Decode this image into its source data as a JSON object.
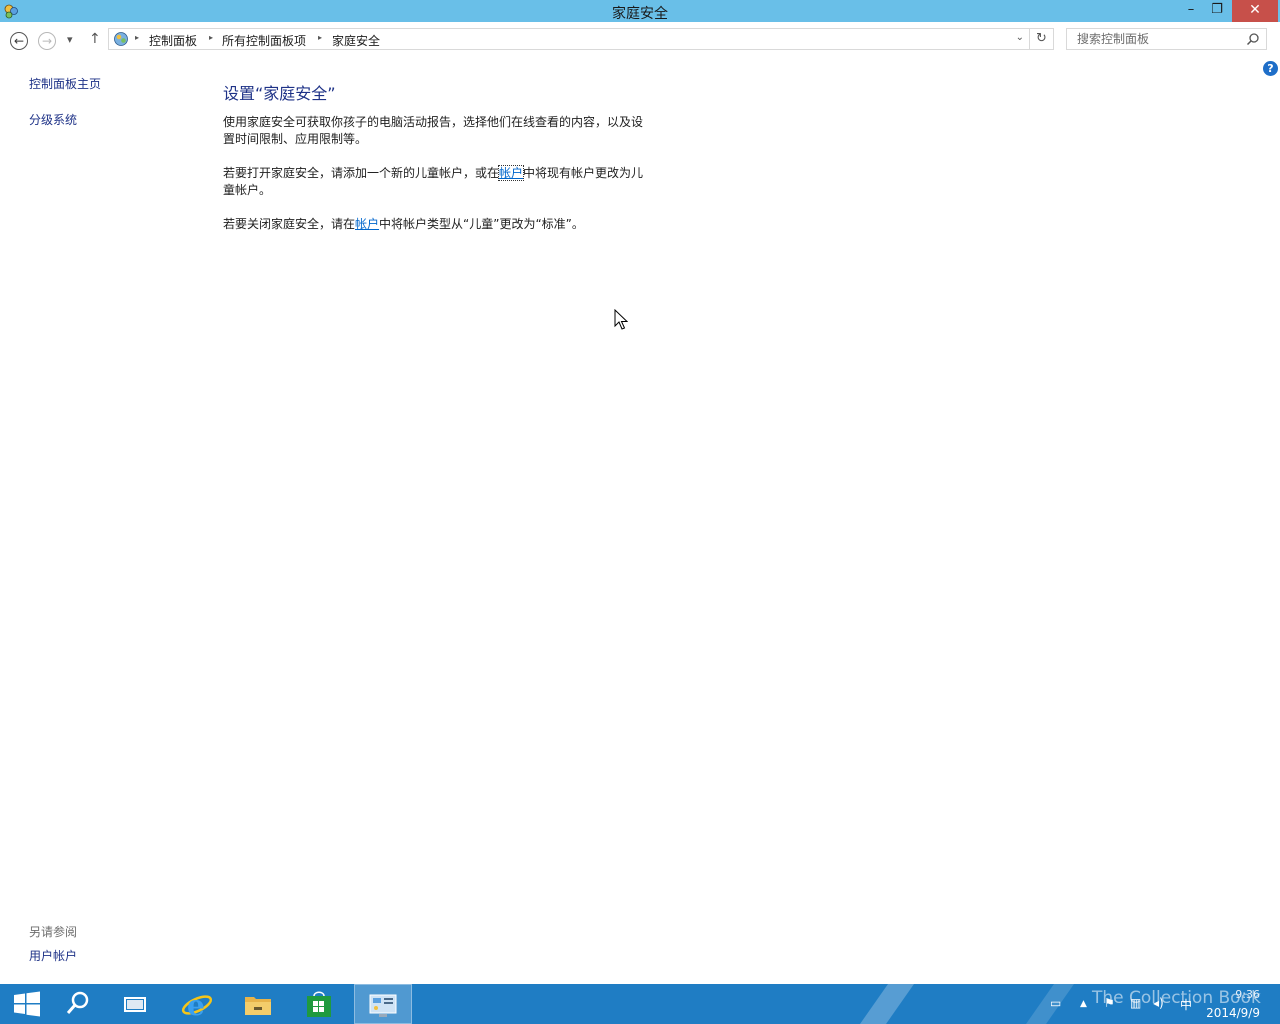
{
  "window": {
    "title": "家庭安全",
    "minimize_glyph": "–",
    "maximize_glyph": "❐",
    "close_glyph": "✕"
  },
  "nav": {
    "back_glyph": "←",
    "forward_glyph": "→",
    "recent_glyph": "▾",
    "up_glyph": "↑",
    "breadcrumbs": [
      "控制面板",
      "所有控制面板项",
      "家庭安全"
    ],
    "crumb_sep": "▸",
    "dropdown_glyph": "⌄",
    "refresh_glyph": "↻",
    "search_placeholder": "搜索控制面板"
  },
  "sidebar": {
    "items": [
      {
        "label": "控制面板主页"
      },
      {
        "label": "分级系统"
      }
    ],
    "see_also_heading": "另请参阅",
    "see_also_items": [
      {
        "label": "用户帐户"
      }
    ]
  },
  "main": {
    "heading": "设置“家庭安全”",
    "para1": "使用家庭安全可获取你孩子的电脑活动报告，选择他们在线查看的内容，以及设置时间限制、应用限制等。",
    "para2_pre": "若要打开家庭安全，请添加一个新的儿童帐户，或在",
    "para2_link": "帐户",
    "para2_post": "中将现有帐户更改为儿童帐户。",
    "para3_pre": "若要关闭家庭安全，请在",
    "para3_link": "帐户",
    "para3_post": "中将帐户类型从“儿童”更改为“标准”。",
    "help_glyph": "?"
  },
  "taskbar": {
    "apps": [
      "start",
      "search",
      "task-view",
      "internet-explorer",
      "file-explorer",
      "store",
      "control-panel"
    ],
    "active_app": "control-panel",
    "tray": {
      "time": "9:36",
      "date": "2014/9/9",
      "ime": "中",
      "watermark": "The Collection Book"
    }
  },
  "colors": {
    "titlebar": "#69bfe8",
    "taskbar": "#1f7dc4",
    "link": "#0066cc",
    "heading": "#1e3287",
    "close_button": "#c7504a"
  }
}
